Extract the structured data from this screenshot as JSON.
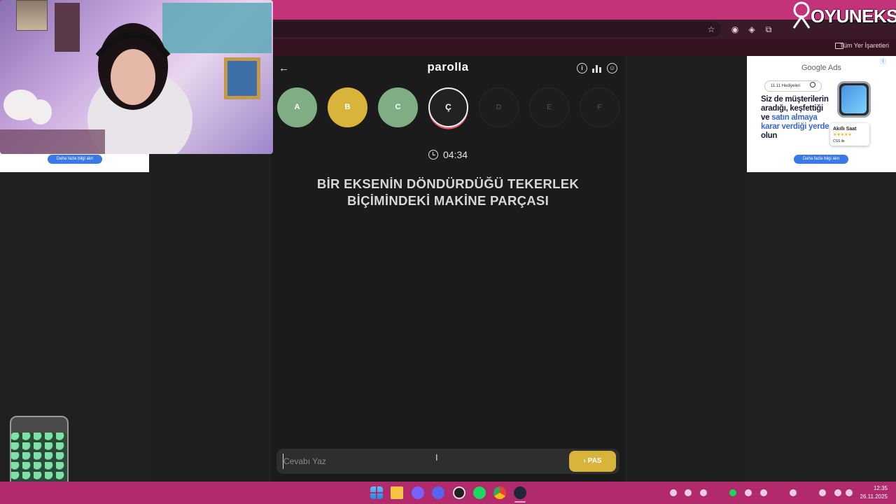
{
  "browser": {
    "bookmarks_label": "Tüm Yer İşaretleri"
  },
  "overlay": {
    "logo_text": "OYUNEKS"
  },
  "app": {
    "title": "parolla",
    "timer": "04:34",
    "question": "BİR EKSENİN DÖNDÜRDÜĞÜ TEKERLEK BİÇİMİNDEKİ MAKİNE PARÇASI",
    "letters": [
      {
        "label": "A",
        "state": "correct"
      },
      {
        "label": "B",
        "state": "passed"
      },
      {
        "label": "C",
        "state": "correct"
      },
      {
        "label": "Ç",
        "state": "current"
      },
      {
        "label": "D",
        "state": "pending"
      },
      {
        "label": "E",
        "state": "pending"
      },
      {
        "label": "F",
        "state": "pending"
      }
    ],
    "answer_placeholder": "Cevabı Yaz",
    "pass_label": "PAS",
    "colors": {
      "correct": "#7fae85",
      "passed": "#d8b53a",
      "current_ring": "#e85a6a"
    }
  },
  "ads": {
    "left_button": "Daha fazla bilgi alın",
    "brand": "Google Ads",
    "search_chip": "11.11 Hediyeleri",
    "headline_parts": [
      "Siz de müşterilerin aradığı, keşfettiği ve ",
      "satın almaya karar verdiği yerde",
      " olun"
    ],
    "card_title": "Akıllı Saat",
    "card_stars": "★★★★★",
    "card_price": "CSS ile",
    "button": "Daha fazla bilgi alın"
  },
  "taskbar": {
    "time": "12:35",
    "date": "26.11.2025",
    "apps": [
      "start-icon",
      "files-icon",
      "vpn-icon",
      "discord-icon",
      "obs-icon",
      "spotify-icon",
      "chrome-icon",
      "steam-icon"
    ]
  }
}
